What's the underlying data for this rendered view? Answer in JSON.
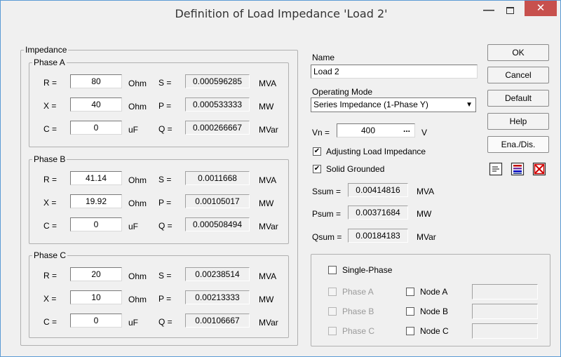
{
  "window": {
    "title": "Definition of Load Impedance 'Load 2'",
    "minimize_glyph": "—",
    "close_glyph": "✕"
  },
  "impedance": {
    "group_label": "Impedance",
    "phases": [
      {
        "label": "Phase A",
        "r_label": "R =",
        "r_value": "80",
        "r_unit": "Ohm",
        "x_label": "X =",
        "x_value": "40",
        "x_unit": "Ohm",
        "c_label": "C =",
        "c_value": "0",
        "c_unit": "uF",
        "s_label": "S =",
        "s_value": "0.000596285",
        "s_unit": "MVA",
        "p_label": "P =",
        "p_value": "0.000533333",
        "p_unit": "MW",
        "q_label": "Q =",
        "q_value": "0.000266667",
        "q_unit": "MVar"
      },
      {
        "label": "Phase B",
        "r_label": "R =",
        "r_value": "41.14",
        "r_unit": "Ohm",
        "x_label": "X =",
        "x_value": "19.92",
        "x_unit": "Ohm",
        "c_label": "C =",
        "c_value": "0",
        "c_unit": "uF",
        "s_label": "S =",
        "s_value": "0.0011668",
        "s_unit": "MVA",
        "p_label": "P =",
        "p_value": "0.00105017",
        "p_unit": "MW",
        "q_label": "Q =",
        "q_value": "0.000508494",
        "q_unit": "MVar"
      },
      {
        "label": "Phase C",
        "r_label": "R =",
        "r_value": "20",
        "r_unit": "Ohm",
        "x_label": "X =",
        "x_value": "10",
        "x_unit": "Ohm",
        "c_label": "C =",
        "c_value": "0",
        "c_unit": "uF",
        "s_label": "S =",
        "s_value": "0.00238514",
        "s_unit": "MVA",
        "p_label": "P =",
        "p_value": "0.00213333",
        "p_unit": "MW",
        "q_label": "Q =",
        "q_value": "0.00106667",
        "q_unit": "MVar"
      }
    ]
  },
  "general": {
    "name_label": "Name",
    "name_value": "Load 2",
    "operating_mode_label": "Operating Mode",
    "operating_mode_value": "Series Impedance (1-Phase Y)",
    "vn_label": "Vn =",
    "vn_value": "400",
    "vn_browse": "...",
    "vn_unit": "V",
    "adjusting_label": "Adjusting Load Impedance",
    "adjusting_checked": true,
    "solid_grounded_label": "Solid Grounded",
    "solid_grounded_checked": true,
    "ssum_label": "Ssum =",
    "ssum_value": "0.00414816",
    "ssum_unit": "MVA",
    "psum_label": "Psum =",
    "psum_value": "0.00371684",
    "psum_unit": "MW",
    "qsum_label": "Qsum =",
    "qsum_value": "0.00184183",
    "qsum_unit": "MVar"
  },
  "single_phase": {
    "single_phase_label": "Single-Phase",
    "phase_a_label": "Phase A",
    "phase_b_label": "Phase B",
    "phase_c_label": "Phase C",
    "node_a_label": "Node A",
    "node_b_label": "Node B",
    "node_c_label": "Node C"
  },
  "buttons": {
    "ok": "OK",
    "cancel": "Cancel",
    "default": "Default",
    "help": "Help",
    "ena_dis": "Ena./Dis."
  },
  "icons": [
    "list-icon",
    "color-lines-icon",
    "delete-box-icon"
  ],
  "colors": {
    "close_red": "#c7504d",
    "accent_blue": "#5b9bd5"
  }
}
